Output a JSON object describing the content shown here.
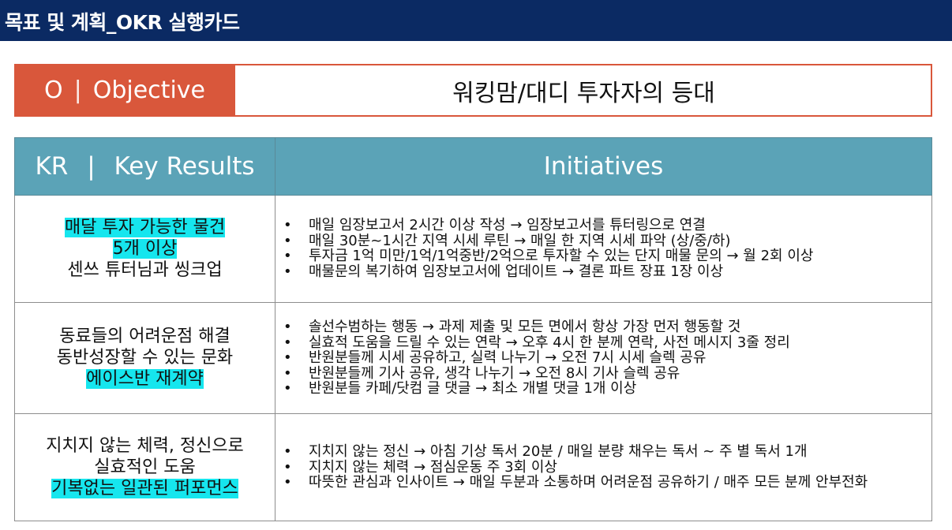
{
  "header": {
    "title": "목표 및 계획_OKR 실행카드"
  },
  "objective": {
    "letter": "O",
    "separator": "|",
    "label": "Objective",
    "value": "워킹맘/대디 투자자의 등대"
  },
  "table": {
    "headers": {
      "kr": "KR",
      "kr_separator": "|",
      "kr_label": "Key Results",
      "initiatives": "Initiatives"
    },
    "rows": [
      {
        "kr_lines": [
          "매달 투자 가능한 물건",
          "5개 이상",
          "센쓰 튜터님과 씽크업"
        ],
        "initiatives": [
          "매일 임장보고서 2시간 이상 작성 → 임장보고서를 튜터링으로 연결",
          "매일 30분~1시간 지역 시세 루틴 → 매일 한 지역 시세 파악 (상/중/하)",
          "투자금 1억 미만/1억/1억중반/2억으로 투자할 수 있는 단지 매물 문의 → 월 2회 이상",
          "매물문의 복기하여 임장보고서에 업데이트 → 결론 파트 장표 1장 이상"
        ]
      },
      {
        "kr_lines": [
          "동료들의 어려운점 해결",
          "동반성장할 수 있는 문화",
          "에이스반 재계약"
        ],
        "initiatives": [
          "솔선수범하는 행동 → 과제 제출 및 모든 면에서 항상 가장 먼저 행동할 것",
          "실효적 도움을 드릴 수 있는 연락 → 오후 4시 한 분께 연락, 사전 메시지 3줄 정리",
          "반원분들께 시세 공유하고, 실력 나누기 → 오전 7시 시세 슬렉 공유",
          "반원분들께 기사 공유, 생각 나누기 → 오전 8시 기사 슬렉 공유",
          "반원분들 카페/닷컴 글 댓글 → 최소 개별 댓글 1개 이상"
        ]
      },
      {
        "kr_lines": [
          "지치지 않는 체력, 정신으로",
          "실효적인 도움",
          "기복없는 일관된 퍼포먼스"
        ],
        "initiatives": [
          "지치지 않는 정신 → 아침 기상 독서 20분 / 매일 분량 채우는 독서 ~ 주 별 독서 1개",
          "지치지 않는 체력 → 점심운동 주 3회 이상",
          "따뜻한 관심과 인사이트 → 매일 두분과 소통하며 어려운점 공유하기 / 매주 모든 분께 안부전화"
        ]
      }
    ]
  },
  "colors": {
    "header_bg": "#0b2a63",
    "objective_accent": "#d9573b",
    "table_header_bg": "#5ba3b7",
    "highlight": "#16e6ee"
  }
}
